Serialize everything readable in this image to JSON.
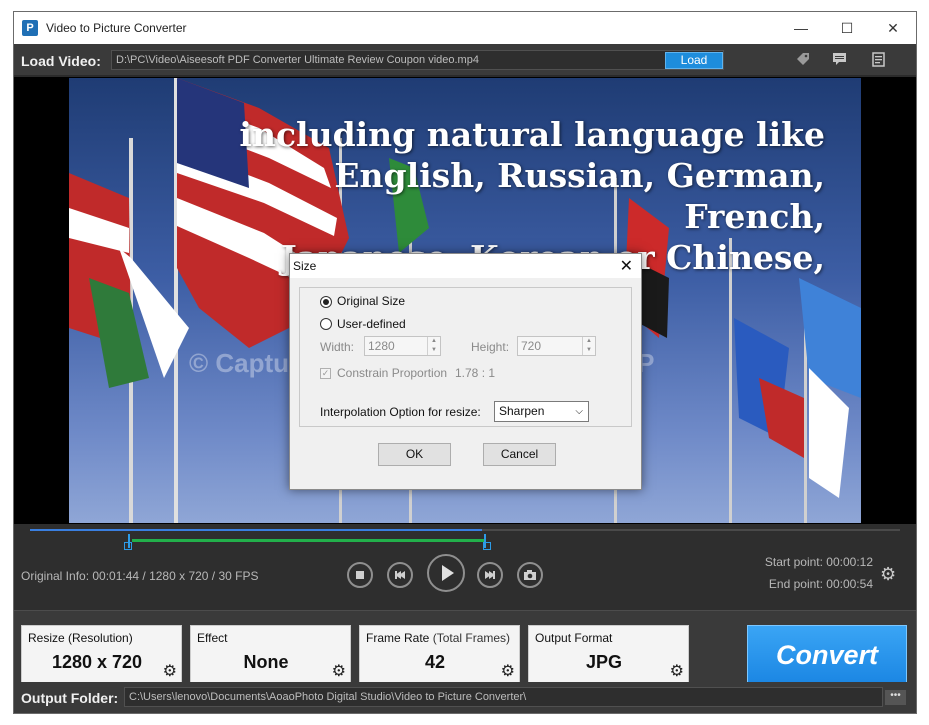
{
  "window": {
    "title": "Video to Picture Converter",
    "minimize_glyph": "—",
    "maximize_glyph": "☐",
    "close_glyph": "✕"
  },
  "toolbar": {
    "load_video_label": "Load Video:",
    "video_path": "D:\\PC\\Video\\Aiseesoft PDF Converter Ultimate Review Coupon video.mp4",
    "load_button": "Load",
    "icons": [
      "tag-icon",
      "comment-icon",
      "document-icon"
    ]
  },
  "video": {
    "caption_lines": [
      "including natural language like",
      "English, Russian, German, French,",
      "Japanese, Korean or Chinese,"
    ],
    "watermark": "© Captured by THESOFTWARE.SHOP"
  },
  "size_dialog": {
    "title": "Size",
    "close_glyph": "✕",
    "option_original": "Original Size",
    "option_user": "User-defined",
    "selected_option": "Original Size",
    "width_label": "Width:",
    "width_value": "1280",
    "height_label": "Height:",
    "height_value": "720",
    "constrain_label": "Constrain Proportion",
    "ratio": "1.78 : 1",
    "interp_label": "Interpolation Option for resize:",
    "interp_value": "Sharpen",
    "ok": "OK",
    "cancel": "Cancel"
  },
  "timeline": {
    "played_fraction": 0.52,
    "range_start_fraction": 0.117,
    "range_end_fraction": 0.523
  },
  "playback": {
    "original_info": "Original Info: 00:01:44 / 1280 x 720 / 30 FPS",
    "start_point": "Start point: 00:00:12",
    "end_point": "End point: 00:00:54",
    "buttons": [
      "stop-icon",
      "prev-icon",
      "play-icon",
      "next-icon",
      "camera-icon"
    ]
  },
  "settings": {
    "resize_title": "Resize (Resolution)",
    "resize_value": "1280 x 720",
    "effect_title": "Effect",
    "effect_value": "None",
    "framerate_title": "Frame Rate",
    "framerate_sub": "(Total Frames)",
    "framerate_value": "42",
    "format_title": "Output Format",
    "format_value": "JPG",
    "convert_label": "Convert"
  },
  "output": {
    "label": "Output Folder:",
    "path": "C:\\Users\\lenovo\\Documents\\AoaoPhoto Digital Studio\\Video to Picture Converter\\",
    "browse": "•••"
  },
  "colors": {
    "accent_blue": "#1e8ddc",
    "range_green": "#22b04b",
    "dark_panel": "#3a3a3a"
  }
}
